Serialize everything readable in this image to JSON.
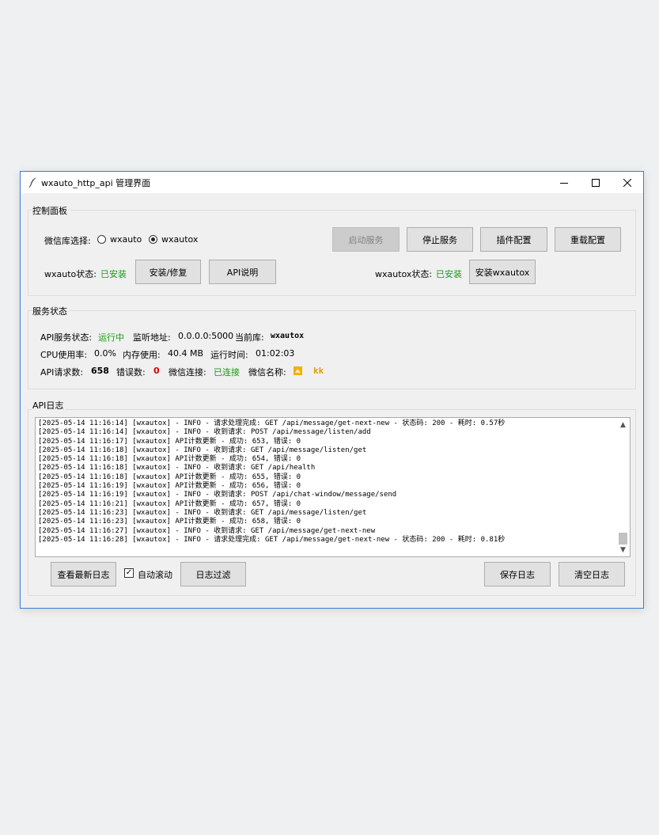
{
  "window": {
    "title": "wxauto_http_api 管理界面",
    "icon": "feather-icon",
    "controls": [
      "minimize-icon",
      "maximize-icon",
      "close-icon"
    ]
  },
  "control_panel": {
    "label": "控制面板",
    "lib_select_label": "微信库选择:",
    "lib_options": [
      {
        "label": "wxauto",
        "selected": false
      },
      {
        "label": "wxautox",
        "selected": true
      }
    ],
    "buttons": {
      "start": "启动服务",
      "stop": "停止服务",
      "plugin": "插件配置",
      "reload": "重载配置",
      "install_repair": "安装/修复",
      "api_doc": "API说明",
      "install_wxautox": "安装wxautox"
    },
    "wxauto_status_label": "wxauto状态:",
    "wxauto_status_value": "已安装",
    "wxautox_status_label": "wxautox状态:",
    "wxautox_status_value": "已安装"
  },
  "service_status": {
    "label": "服务状态",
    "api_status_label": "API服务状态:",
    "api_status_value": "运行中",
    "listen_label": "监听地址:",
    "listen_value": "0.0.0.0:5000",
    "current_lib_label": "当前库:",
    "current_lib_value": "wxautox",
    "cpu_label": "CPU使用率:",
    "cpu_value": "0.0%",
    "mem_label": "内存使用:",
    "mem_value": "40.4 MB",
    "uptime_label": "运行时间:",
    "uptime_value": "01:02:03",
    "requests_label": "API请求数:",
    "requests_value": "658",
    "errors_label": "错误数:",
    "errors_value": "0",
    "wechat_conn_label": "微信连接:",
    "wechat_conn_value": "已连接",
    "wechat_name_label": "微信名称:",
    "wechat_name_value": "kk"
  },
  "api_log": {
    "label": "API日志",
    "lines": [
      "[2025-05-14 11:16:14] [wxautox] - INFO - 请求处理完成: GET /api/message/get-next-new - 状态码: 200 - 耗时: 0.57秒",
      "[2025-05-14 11:16:14] [wxautox] - INFO - 收到请求: POST /api/message/listen/add",
      "[2025-05-14 11:16:17] [wxautox] API计数更新 - 成功: 653, 错误: 0",
      "[2025-05-14 11:16:18] [wxautox] - INFO - 收到请求: GET /api/message/listen/get",
      "[2025-05-14 11:16:18] [wxautox] API计数更新 - 成功: 654, 错误: 0",
      "[2025-05-14 11:16:18] [wxautox] - INFO - 收到请求: GET /api/health",
      "[2025-05-14 11:16:18] [wxautox] API计数更新 - 成功: 655, 错误: 0",
      "[2025-05-14 11:16:19] [wxautox] API计数更新 - 成功: 656, 错误: 0",
      "[2025-05-14 11:16:19] [wxautox] - INFO - 收到请求: POST /api/chat-window/message/send",
      "[2025-05-14 11:16:21] [wxautox] API计数更新 - 成功: 657, 错误: 0",
      "[2025-05-14 11:16:23] [wxautox] - INFO - 收到请求: GET /api/message/listen/get",
      "[2025-05-14 11:16:23] [wxautox] API计数更新 - 成功: 658, 错误: 0",
      "[2025-05-14 11:16:27] [wxautox] - INFO - 收到请求: GET /api/message/get-next-new",
      "[2025-05-14 11:16:28] [wxautox] - INFO - 请求处理完成: GET /api/message/get-next-new - 状态码: 200 - 耗时: 0.81秒"
    ],
    "buttons": {
      "view_latest": "查看最新日志",
      "auto_scroll": "自动滚动",
      "filter": "日志过滤",
      "save": "保存日志",
      "clear": "清空日志"
    },
    "auto_scroll_checked": true
  },
  "colors": {
    "status_ok": "#10a010",
    "error": "#e00000",
    "name_accent": "#e0a000",
    "window_border": "#3b7fd4"
  }
}
